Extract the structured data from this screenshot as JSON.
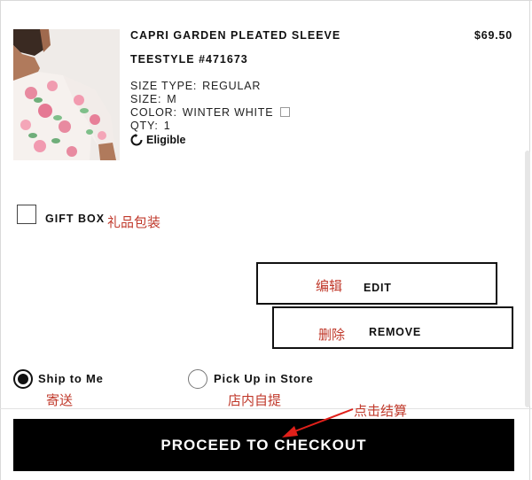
{
  "product": {
    "name": "CAPRI GARDEN PLEATED SLEEVE",
    "price": "$69.50",
    "style": "TEESTYLE #471673",
    "attributes": [
      {
        "label": "SIZE TYPE:",
        "value": "REGULAR"
      },
      {
        "label": "SIZE:",
        "value": "M"
      },
      {
        "label": "COLOR:",
        "value": "WINTER WHITE"
      },
      {
        "label": "QTY:",
        "value": "1"
      }
    ],
    "eligible_label": "Eligible",
    "image_icon": "floral-blouse-photo"
  },
  "gift": {
    "label": "GIFT BOX",
    "annotation": "礼品包装"
  },
  "actions": {
    "edit_label": "EDIT",
    "edit_annotation": "编辑",
    "remove_label": "REMOVE",
    "remove_annotation": "删除"
  },
  "fulfillment": {
    "options": [
      {
        "label": "Ship to Me",
        "annotation": "寄送",
        "selected": true
      },
      {
        "label": "Pick Up in Store",
        "annotation": "店内自提",
        "selected": false
      }
    ]
  },
  "checkout": {
    "label": "PROCEED TO CHECKOUT",
    "annotation": "点击结算"
  },
  "colors": {
    "annotation": "#c0392b",
    "button_bg": "#000000",
    "button_text": "#ffffff"
  }
}
